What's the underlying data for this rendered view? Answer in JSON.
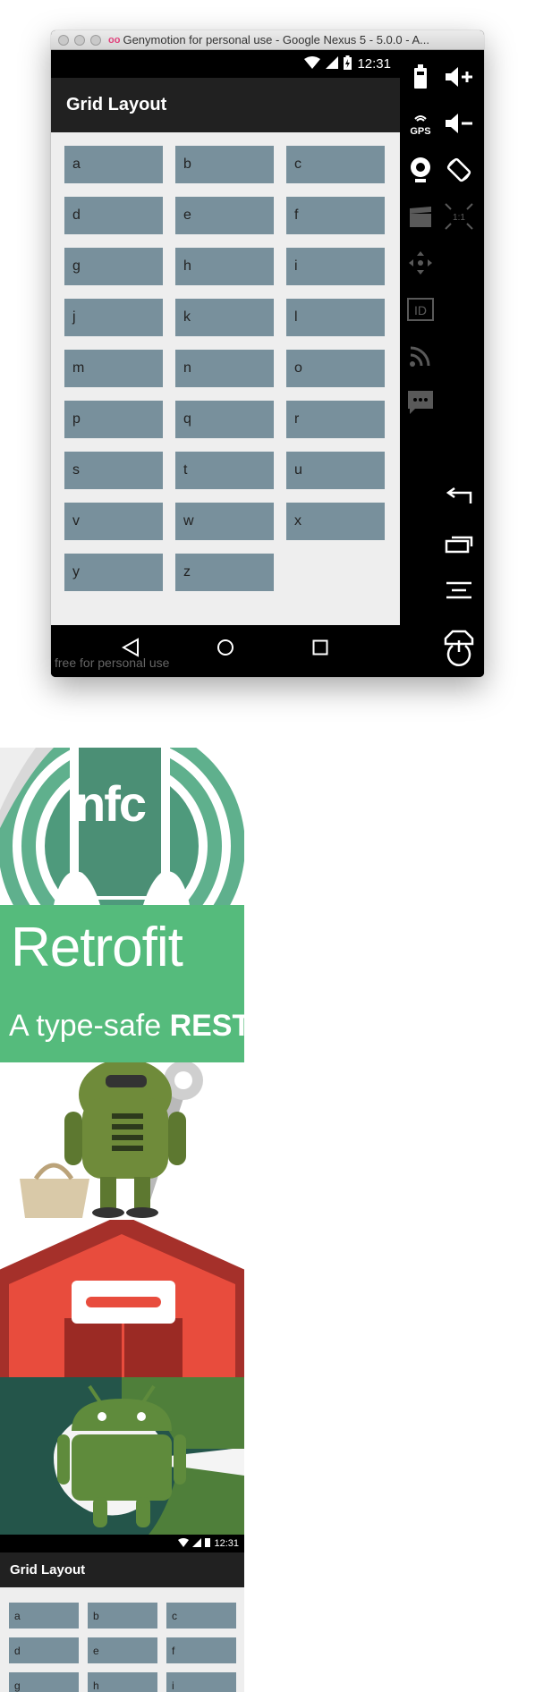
{
  "window": {
    "title": "Genymotion for personal use - Google Nexus 5 - 5.0.0 - A..."
  },
  "status_bar": {
    "time": "12:31"
  },
  "app": {
    "title": "Grid Layout",
    "grid_items": [
      "a",
      "b",
      "c",
      "d",
      "e",
      "f",
      "g",
      "h",
      "i",
      "j",
      "k",
      "l",
      "m",
      "n",
      "o",
      "p",
      "q",
      "r",
      "s",
      "t",
      "u",
      "v",
      "w",
      "x",
      "y",
      "z"
    ]
  },
  "watermark": "free for personal use",
  "side_panel": {
    "gps_label": "GPS",
    "id_label": "ID",
    "scale_label": "1:1"
  },
  "thumbnails": {
    "nfc_text": "nfc",
    "retrofit_title": "Retrofit",
    "retrofit_sub_plain": "A type-safe",
    "retrofit_sub_bold": "REST"
  },
  "mini": {
    "time": "12:31",
    "title": "Grid Layout",
    "grid_items": [
      "a",
      "b",
      "c",
      "d",
      "e",
      "f",
      "g",
      "h",
      "i"
    ]
  },
  "colors": {
    "grid_cell": "#78909c",
    "toolbar": "#212121",
    "content_bg": "#eeeeee",
    "retrofit_green": "#55bb7c",
    "barn_red": "#e84c3d"
  }
}
